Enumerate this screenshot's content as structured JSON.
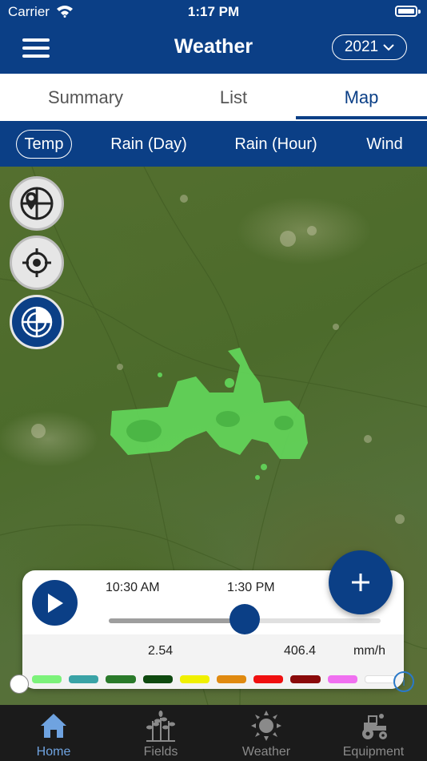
{
  "status": {
    "carrier": "Carrier",
    "time": "1:17 PM"
  },
  "header": {
    "title": "Weather",
    "year": "2021"
  },
  "tabs": [
    {
      "label": "Summary",
      "active": false
    },
    {
      "label": "List",
      "active": false
    },
    {
      "label": "Map",
      "active": true
    }
  ],
  "layers": [
    {
      "label": "Temp",
      "active": true
    },
    {
      "label": "Rain (Day)",
      "active": false
    },
    {
      "label": "Rain (Hour)",
      "active": false
    },
    {
      "label": "Wind",
      "active": false
    }
  ],
  "map_controls": {
    "icons": [
      "map-pin-grid-icon",
      "locate-icon",
      "radar-icon"
    ]
  },
  "playback": {
    "start_time": "10:30 AM",
    "current_time": "1:30 PM",
    "progress": 0.5,
    "min_value": "2.54",
    "max_value": "406.4",
    "unit": "mm/h",
    "legend_colors": [
      "#7cf27a",
      "#3aa3a6",
      "#2a7a2a",
      "#0f4a10",
      "#f0f000",
      "#e08a10",
      "#f01010",
      "#8a0a0a",
      "#f070f0",
      "#ffffff"
    ]
  },
  "accent_color": "#0b3f86",
  "nav": [
    {
      "label": "Home",
      "icon": "home-icon",
      "active": true
    },
    {
      "label": "Fields",
      "icon": "plants-icon",
      "active": false
    },
    {
      "label": "Weather",
      "icon": "sun-icon",
      "active": false
    },
    {
      "label": "Equipment",
      "icon": "tractor-icon",
      "active": false
    }
  ]
}
